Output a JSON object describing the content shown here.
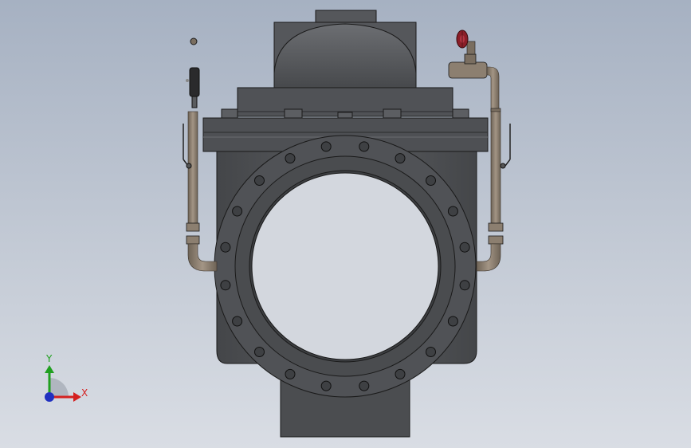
{
  "viewport": {
    "background_top": "#a6b1c2",
    "background_bottom": "#d9dde4"
  },
  "model": {
    "body_color": "#54565a",
    "body_dark": "#3a3b3e",
    "outline_color": "#1a1a1a",
    "pipe_color": "#8a7d6e",
    "handwheel_color": "#8b1e28"
  },
  "triad": {
    "x_label": "X",
    "y_label": "Y",
    "x_color": "#d42020",
    "y_color": "#20a020",
    "z_color": "#2030c0"
  }
}
